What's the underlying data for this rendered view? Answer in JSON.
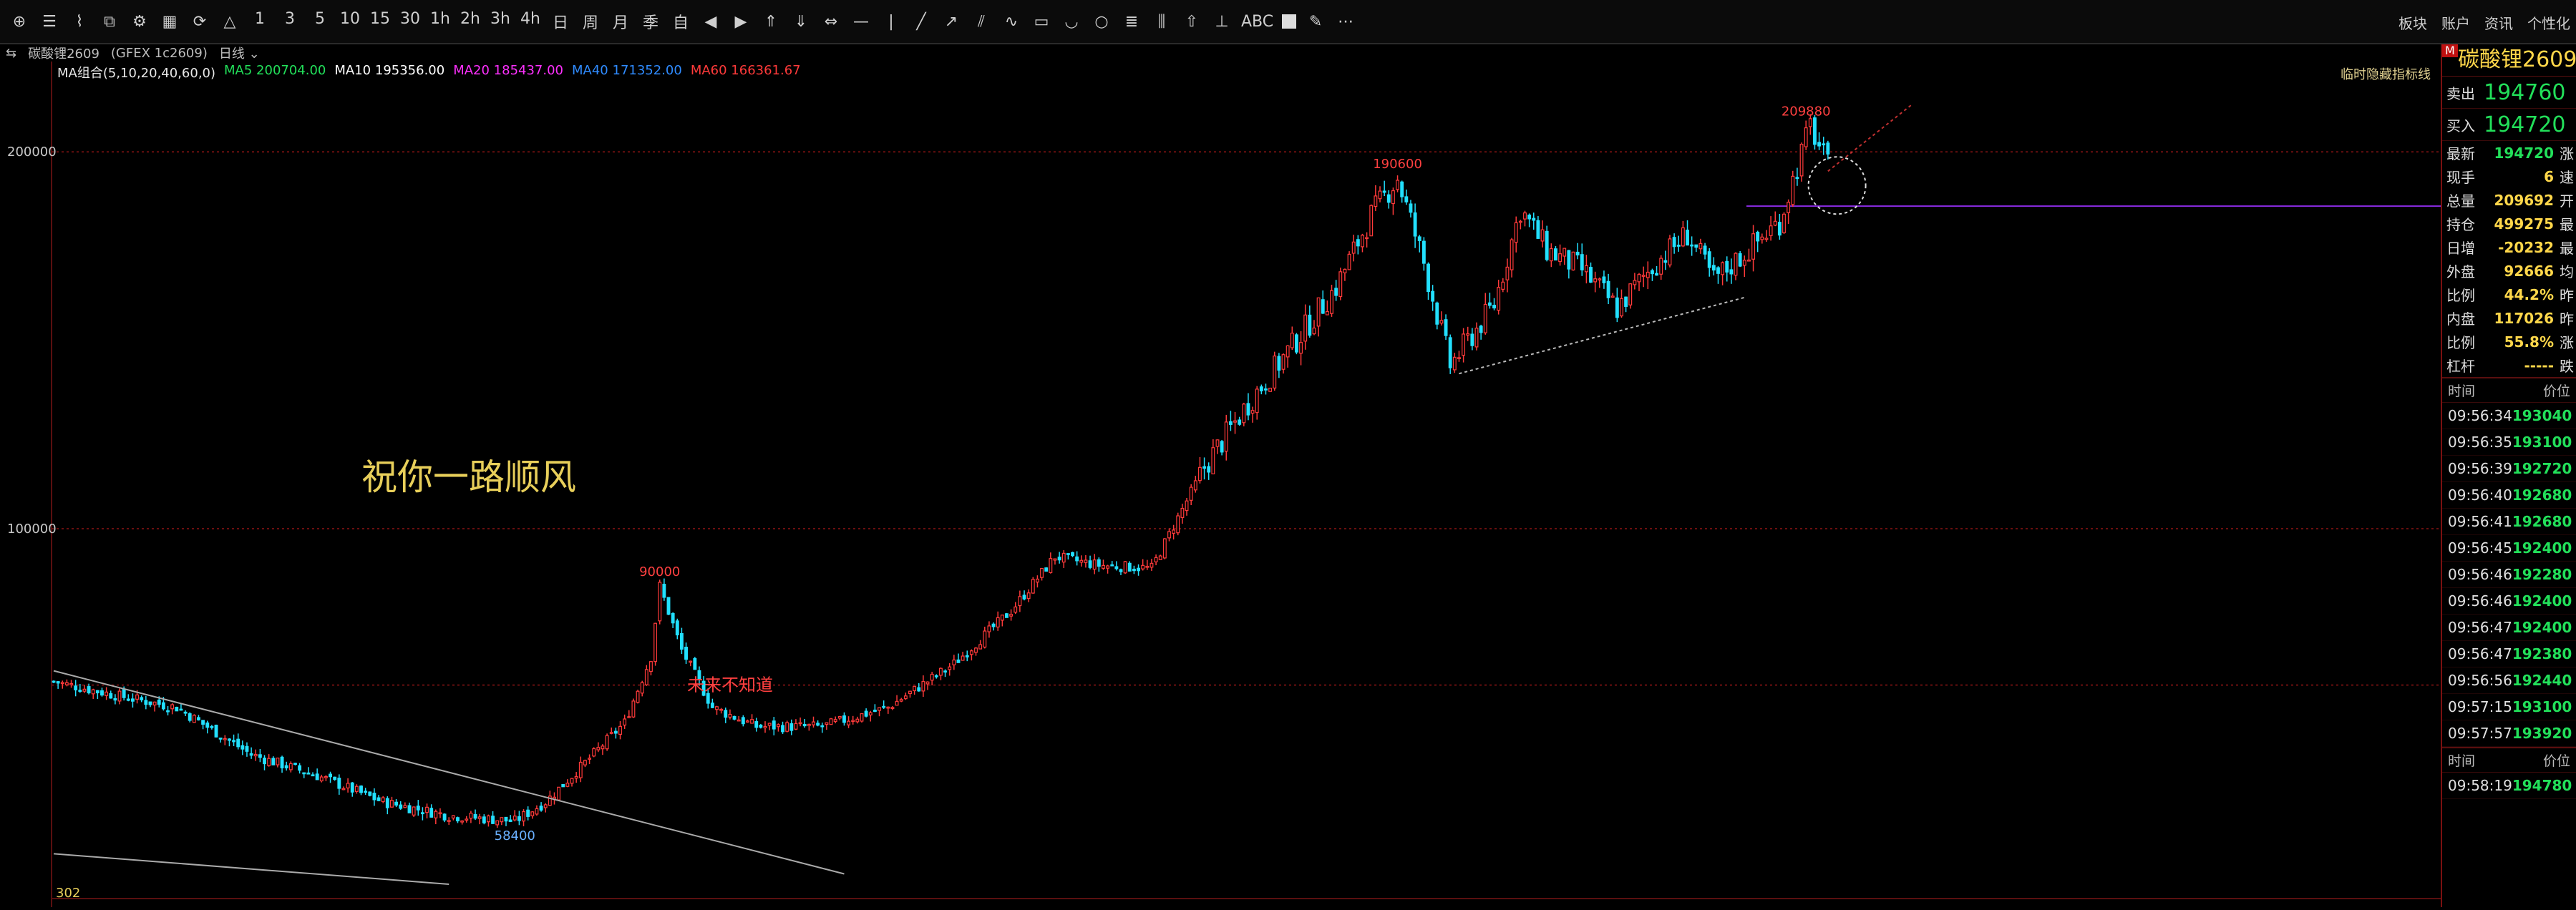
{
  "toolbar": {
    "periods": [
      "1",
      "3",
      "5",
      "10",
      "15",
      "30",
      "1h",
      "2h",
      "3h",
      "4h",
      "日",
      "周",
      "月",
      "季",
      "自"
    ],
    "text_tool_label": "ABC",
    "right_menu": [
      "板块",
      "账户",
      "资讯",
      "个性化"
    ]
  },
  "symbol_bar": {
    "name": "碳酸锂2609",
    "code": "(GFEX 1c2609)",
    "period": "日线"
  },
  "ma_legend": {
    "label": "MA组合(5,10,20,40,60,0)",
    "ma5": "MA5 200704.00",
    "ma10": "MA10 195356.00",
    "ma20": "MA20 185437.00",
    "ma40": "MA40 171352.00",
    "ma60": "MA60 166361.67",
    "colors": {
      "label": "#e8e8e8",
      "ma5": "#22e05a",
      "ma10": "#ffffff",
      "ma20": "#ff30ff",
      "ma40": "#2f8bff",
      "ma60": "#ff3a3a"
    }
  },
  "chart_note_right": "临时隐藏指标线",
  "chart_data": {
    "type": "candlestick",
    "y_scale": "log",
    "ylim": [
      52000,
      230000
    ],
    "y_ticks": [
      200000,
      100000
    ],
    "y_tick_labels": [
      "200000",
      "100000"
    ],
    "annotations": [
      {
        "text": "209880",
        "value": 209880
      },
      {
        "text": "190600",
        "value": 190600
      },
      {
        "text": "90000",
        "value": 90000
      },
      {
        "text": "58400",
        "value": 58400
      }
    ],
    "future_label": "未来不知道",
    "volume_label": "302",
    "up_color": "#ff3a3a",
    "down_color": "#22e0ff",
    "price_levels": [
      {
        "value": 200000,
        "color": "#6a0f0f"
      },
      {
        "value": 100000,
        "color": "#6a0f0f"
      },
      {
        "value": 75000,
        "color": "#6a0f0f"
      },
      {
        "value": 181000,
        "color": "#8a2be2"
      }
    ],
    "waypoints": [
      [
        0,
        75500
      ],
      [
        15,
        73500
      ],
      [
        28,
        72000
      ],
      [
        45,
        66000
      ],
      [
        60,
        63500
      ],
      [
        75,
        60500
      ],
      [
        90,
        59000
      ],
      [
        105,
        58400
      ],
      [
        112,
        60500
      ],
      [
        120,
        64500
      ],
      [
        130,
        70000
      ],
      [
        136,
        79000
      ],
      [
        138,
        90000
      ],
      [
        143,
        80000
      ],
      [
        150,
        72000
      ],
      [
        160,
        69500
      ],
      [
        175,
        69500
      ],
      [
        190,
        72000
      ],
      [
        205,
        78000
      ],
      [
        218,
        86000
      ],
      [
        228,
        95000
      ],
      [
        238,
        93500
      ],
      [
        250,
        93000
      ],
      [
        262,
        112000
      ],
      [
        272,
        126000
      ],
      [
        280,
        137000
      ],
      [
        292,
        156000
      ],
      [
        300,
        178000
      ],
      [
        306,
        190600
      ],
      [
        312,
        163000
      ],
      [
        318,
        135000
      ],
      [
        328,
        151000
      ],
      [
        334,
        180000
      ],
      [
        340,
        167000
      ],
      [
        348,
        161000
      ],
      [
        356,
        150000
      ],
      [
        364,
        162000
      ],
      [
        372,
        172000
      ],
      [
        378,
        158000
      ],
      [
        385,
        166000
      ],
      [
        393,
        176000
      ],
      [
        400,
        209880
      ],
      [
        404,
        194720
      ]
    ],
    "candle_count": 405,
    "trendlines": [
      {
        "from": [
          0,
          77000
        ],
        "to": [
          180,
          53000
        ],
        "color": "#aaaaaa"
      },
      {
        "from": [
          0,
          55000
        ],
        "to": [
          90,
          52000
        ],
        "color": "#aaaaaa"
      },
      {
        "from": [
          320,
          133000
        ],
        "to": [
          385,
          153000
        ],
        "color": "#bbbbbb",
        "dashed": true
      },
      {
        "from": [
          404,
          193000
        ],
        "to": [
          423,
          218000
        ],
        "color": "#c03030",
        "dashed": true
      }
    ],
    "overlay_text": "祝你一路顺风"
  },
  "quote_panel": {
    "title": "碳酸锂2609",
    "badge": "M",
    "sell": {
      "label": "卖出",
      "value": "194760"
    },
    "buy": {
      "label": "买入",
      "value": "194720"
    },
    "rows": [
      {
        "label": "最新",
        "value": "194720",
        "aux": "涨",
        "color": "#22e05a"
      },
      {
        "label": "现手",
        "value": "6",
        "aux": "速",
        "color": "#ffd74a"
      },
      {
        "label": "总量",
        "value": "209692",
        "aux": "开",
        "color": "#ffd74a"
      },
      {
        "label": "持仓",
        "value": "499275",
        "aux": "最",
        "color": "#ffd74a"
      },
      {
        "label": "日增",
        "value": "-20232",
        "aux": "最",
        "color": "#ffd74a"
      },
      {
        "label": "外盘",
        "value": "92666",
        "aux": "均",
        "color": "#ffd74a"
      },
      {
        "label": "比例",
        "value": "44.2%",
        "aux": "昨",
        "color": "#ffd74a"
      },
      {
        "label": "内盘",
        "value": "117026",
        "aux": "昨",
        "color": "#ffd74a"
      },
      {
        "label": "比例",
        "value": "55.8%",
        "aux": "涨",
        "color": "#ffd74a"
      },
      {
        "label": "杠杆",
        "value": "-----",
        "aux": "跌",
        "color": "#ffd74a"
      }
    ],
    "ticks_header": {
      "time": "时间",
      "price": "价位"
    },
    "ticks": [
      {
        "time": "09:56:34",
        "price": "193040"
      },
      {
        "time": "09:56:35",
        "price": "193100"
      },
      {
        "time": "09:56:39",
        "price": "192720"
      },
      {
        "time": "09:56:40",
        "price": "192680"
      },
      {
        "time": "09:56:41",
        "price": "192680"
      },
      {
        "time": "09:56:45",
        "price": "192400"
      },
      {
        "time": "09:56:46",
        "price": "192280"
      },
      {
        "time": "09:56:46",
        "price": "192400"
      },
      {
        "time": "09:56:47",
        "price": "192400"
      },
      {
        "time": "09:56:47",
        "price": "192380"
      },
      {
        "time": "09:56:56",
        "price": "192440"
      },
      {
        "time": "09:57:15",
        "price": "193100"
      },
      {
        "time": "09:57:57",
        "price": "193920"
      }
    ],
    "ticks2_header": {
      "time": "时间",
      "price": "价位"
    },
    "ticks2": [
      {
        "time": "09:58:19",
        "price": "194780"
      }
    ]
  }
}
